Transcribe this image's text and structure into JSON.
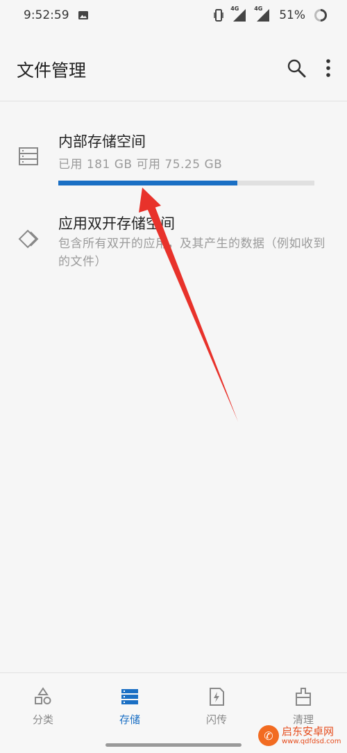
{
  "status_bar": {
    "time": "9:52:59",
    "battery_percent": "51%",
    "network_label_1": "4G",
    "network_label_2": "4G",
    "icons": [
      "image-icon",
      "vibrate-icon",
      "signal-icon",
      "battery-icon"
    ]
  },
  "app_bar": {
    "title": "文件管理",
    "actions": [
      "search-icon",
      "more-vert-icon"
    ]
  },
  "storage": {
    "internal": {
      "title": "内部存储空间",
      "summary": "已用 181 GB  可用 75.25 GB",
      "used_fraction": 0.7
    },
    "dual_app": {
      "title": "应用双开存储空间",
      "description": "包含所有双开的应用，及其产生的数据（例如收到的文件）"
    }
  },
  "bottom_nav": {
    "items": [
      {
        "label": "分类",
        "icon": "category-icon",
        "active": false
      },
      {
        "label": "存储",
        "icon": "storage-icon",
        "active": true
      },
      {
        "label": "闪传",
        "icon": "flash-transfer-icon",
        "active": false
      },
      {
        "label": "清理",
        "icon": "clean-icon",
        "active": false
      }
    ]
  },
  "watermark": {
    "name": "启东安卓网",
    "url": "www.qdfdsd.com"
  },
  "colors": {
    "accent": "#1a6fc4",
    "arrow": "#e8322b"
  }
}
